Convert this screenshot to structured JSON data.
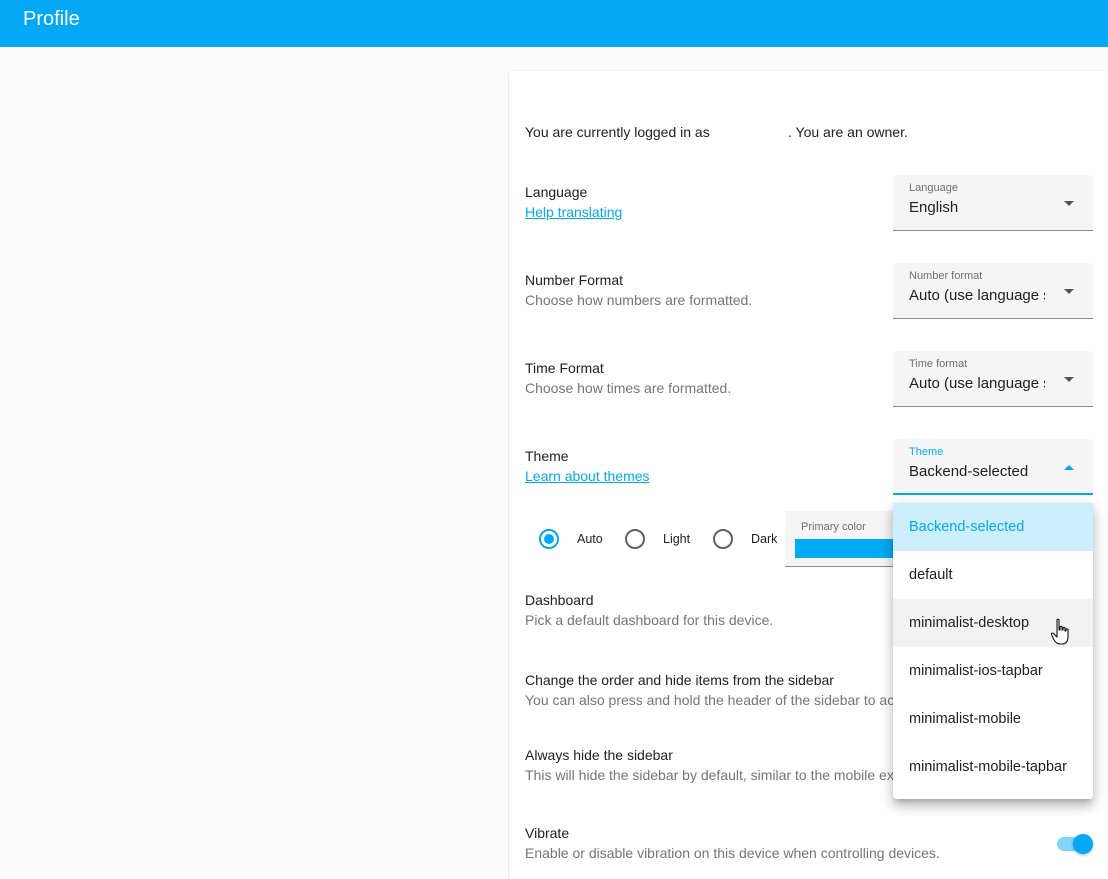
{
  "header": {
    "title": "Profile"
  },
  "profile": {
    "logged_in_prefix": "You are currently logged in as",
    "logged_in_suffix": ". You are an owner."
  },
  "language": {
    "title": "Language",
    "link": "Help translating",
    "field_label": "Language",
    "field_value": "English"
  },
  "number_format": {
    "title": "Number Format",
    "description": "Choose how numbers are formatted.",
    "field_label": "Number format",
    "field_value": "Auto (use language setting)"
  },
  "time_format": {
    "title": "Time Format",
    "description": "Choose how times are formatted.",
    "field_label": "Time format",
    "field_value": "Auto (use language setting)"
  },
  "theme": {
    "title": "Theme",
    "link": "Learn about themes",
    "field_label": "Theme",
    "field_value": "Backend-selected",
    "modes": [
      "Auto",
      "Light",
      "Dark"
    ],
    "selected_mode": "Auto",
    "primary_color_label": "Primary color",
    "primary_color": "#03a9f4",
    "options": [
      "Backend-selected",
      "default",
      "minimalist-desktop",
      "minimalist-ios-tapbar",
      "minimalist-mobile",
      "minimalist-mobile-tapbar"
    ]
  },
  "dashboard": {
    "title": "Dashboard",
    "description": "Pick a default dashboard for this device."
  },
  "sidebar_order": {
    "title": "Change the order and hide items from the sidebar",
    "description": "You can also press and hold the header of the sidebar to activate edit mode."
  },
  "hide_sidebar": {
    "title": "Always hide the sidebar",
    "description": "This will hide the sidebar by default, similar to the mobile experience."
  },
  "vibrate": {
    "title": "Vibrate",
    "description": "Enable or disable vibration on this device when controlling devices.",
    "enabled": true
  },
  "colors": {
    "accent": "#03a9f4",
    "header": "#03a9f4"
  }
}
